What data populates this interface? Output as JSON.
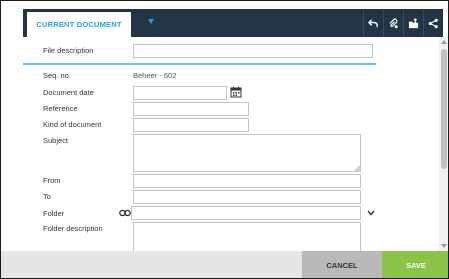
{
  "header": {
    "tab_label": "CURRENT DOCUMENT",
    "actions": [
      "undo-icon",
      "attach-icon",
      "folder-upload-icon",
      "share-icon"
    ]
  },
  "form": {
    "file_description": {
      "label": "File description",
      "value": ""
    },
    "seq_no": {
      "label": "Seq. no.",
      "value": "Beheer - 602"
    },
    "document_date": {
      "label": "Document date",
      "value": ""
    },
    "reference": {
      "label": "Reference",
      "value": ""
    },
    "kind_of_document": {
      "label": "Kind of document",
      "value": ""
    },
    "subject": {
      "label": "Subject",
      "value": ""
    },
    "from": {
      "label": "From",
      "value": ""
    },
    "to": {
      "label": "To",
      "value": ""
    },
    "folder": {
      "label": "Folder",
      "value": ""
    },
    "folder_description": {
      "label": "Folder description",
      "value": ""
    }
  },
  "footer": {
    "cancel_label": "CANCEL",
    "save_label": "SAVE"
  },
  "colors": {
    "header_bg": "#243447",
    "accent": "#2a9fd6",
    "divider": "#69c2e0",
    "save_bg": "#8bc34a",
    "cancel_bg": "#b9b9b9"
  }
}
